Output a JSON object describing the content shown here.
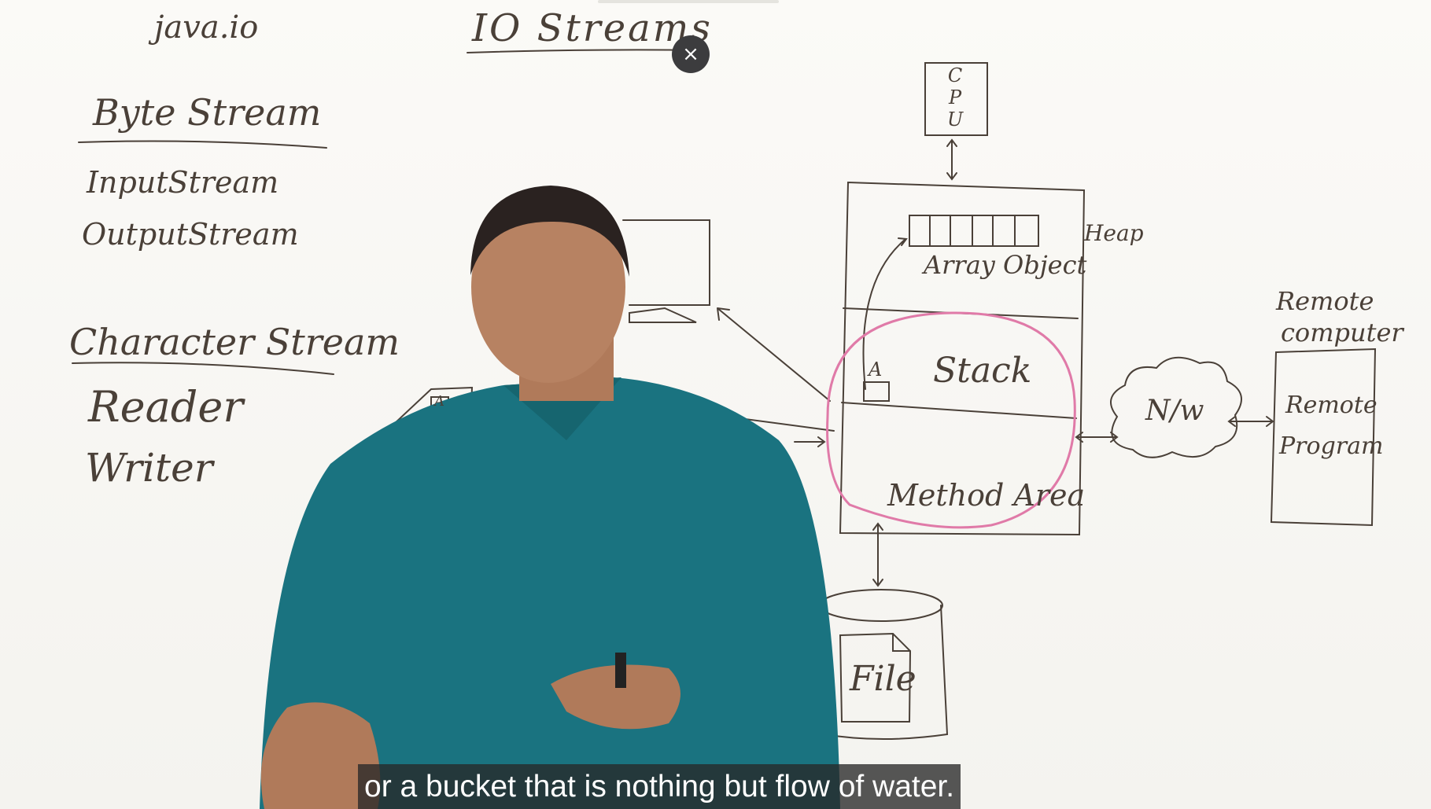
{
  "board": {
    "package": "java.io",
    "title": "IO Streams",
    "byte_stream": "Byte Stream",
    "byte_items": [
      "InputStream",
      "OutputStream"
    ],
    "char_stream": "Character Stream",
    "char_items": [
      "Reader",
      "Writer"
    ],
    "cpu": [
      "C",
      "P",
      "U"
    ],
    "heap": "Heap",
    "array_object": "Array Object",
    "stack": "Stack",
    "var_a": "A",
    "method_area": "Method Area",
    "network": "N/w",
    "remote_computer_1": "Remote",
    "remote_computer_2": "computer",
    "remote_program_1": "Remote",
    "remote_program_2": "Program",
    "file": "File",
    "keyboard_key": "A"
  },
  "overlay": {
    "close_icon": "close-icon",
    "close_glyph": "×",
    "subtitle": "or a bucket that is nothing but flow of water."
  },
  "colors": {
    "ink": "#4a4038",
    "marker_pink": "#e07aa8",
    "shirt": "#1a7380"
  }
}
